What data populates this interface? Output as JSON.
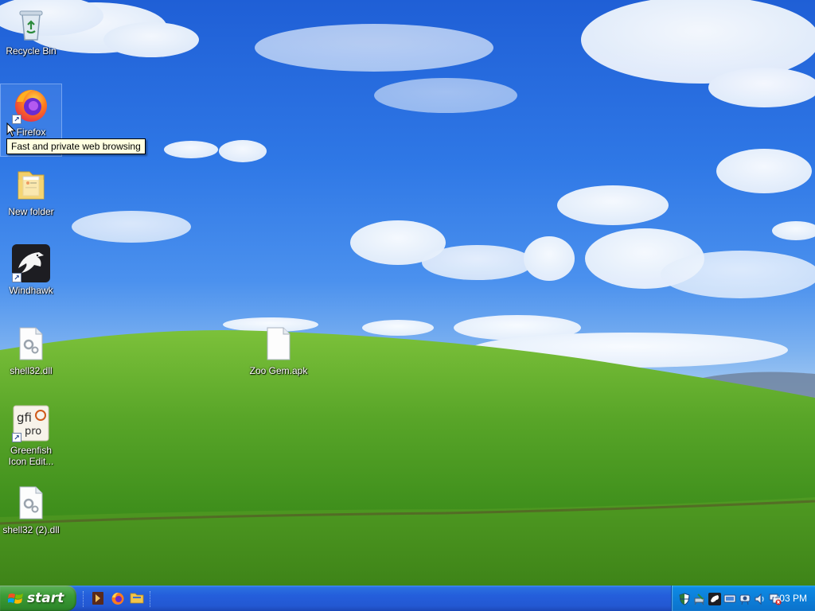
{
  "desktop": {
    "icons": [
      {
        "id": "recycle-bin",
        "label": "Recycle Bin",
        "icon": "recycle-bin-icon",
        "shortcut": false
      },
      {
        "id": "firefox",
        "label": "Firefox",
        "icon": "firefox-icon",
        "shortcut": true
      },
      {
        "id": "new-folder",
        "label": "New folder",
        "icon": "folder-icon",
        "shortcut": false
      },
      {
        "id": "windhawk",
        "label": "Windhawk",
        "icon": "windhawk-icon",
        "shortcut": true
      },
      {
        "id": "shell32",
        "label": "shell32.dll",
        "icon": "dll-file-icon",
        "shortcut": false
      },
      {
        "id": "greenfish",
        "label": "Greenfish Icon Edit...",
        "icon": "greenfish-icon",
        "shortcut": true
      },
      {
        "id": "shell32-2",
        "label": "shell32 (2).dll",
        "icon": "dll-file-icon",
        "shortcut": false
      },
      {
        "id": "zoo-gem",
        "label": "Zoo Gem.apk",
        "icon": "blank-file-icon",
        "shortcut": false
      }
    ],
    "tooltip": "Fast and private web browsing"
  },
  "taskbar": {
    "start_label": "start",
    "quick_launch": [
      {
        "name": "media-player-icon"
      },
      {
        "name": "firefox-icon"
      },
      {
        "name": "file-explorer-icon"
      }
    ],
    "tray_icons": [
      {
        "name": "security-shield-icon"
      },
      {
        "name": "safely-remove-hardware-icon"
      },
      {
        "name": "windhawk-tray-icon"
      },
      {
        "name": "network-icon"
      },
      {
        "name": "webcam-icon"
      },
      {
        "name": "volume-icon"
      },
      {
        "name": "network-disconnected-icon"
      }
    ],
    "clock": "7:03 PM"
  },
  "colors": {
    "taskbar": "#245edb",
    "start_button": "#3c9b36",
    "tray": "#0c7fd9",
    "tooltip_bg": "#ffffe1"
  }
}
